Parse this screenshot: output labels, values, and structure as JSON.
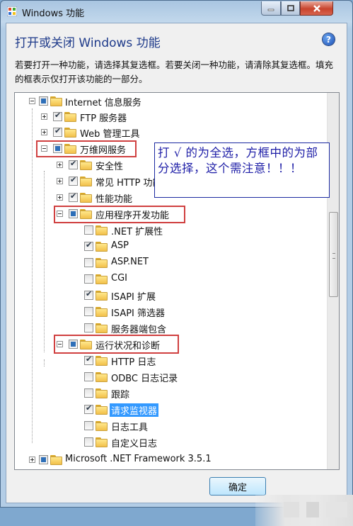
{
  "window": {
    "title": "Windows 功能",
    "heading": "打开或关闭 Windows 功能",
    "description": "若要打开一种功能，请选择其复选框。若要关闭一种功能，请清除其复选框。填充的框表示仅打开该功能的一部分。",
    "help_glyph": "?"
  },
  "tree": {
    "internet_info_services": "Internet 信息服务",
    "ftp_server": "FTP 服务器",
    "web_management_tools": "Web 管理工具",
    "www_services": "万维网服务",
    "security": "安全性",
    "common_http": "常见 HTTP 功能",
    "performance": "性能功能",
    "app_dev": "应用程序开发功能",
    "net_extensibility": ".NET 扩展性",
    "asp": "ASP",
    "aspnet": "ASP.NET",
    "cgi": "CGI",
    "isapi_ext": "ISAPI 扩展",
    "isapi_filters": "ISAPI 筛选器",
    "ssi": "服务器端包含",
    "health_diag": "运行状况和诊断",
    "http_logging": "HTTP 日志",
    "odbc_logging": "ODBC 日志记录",
    "tracing": "跟踪",
    "request_monitor": "请求监视器",
    "logging_tools": "日志工具",
    "custom_logging": "自定义日志",
    "dotnet_framework": "Microsoft .NET Framework 3.5.1"
  },
  "annotation": {
    "text": "打 √ 的为全选，方框中的为部分选择，这个需注意！！！"
  },
  "buttons": {
    "ok_label": "确定"
  },
  "colors": {
    "selection": "#3399ff",
    "heading": "#1e3a8a",
    "annotation_text": "#2020a8",
    "highlight_box": "#d04040"
  }
}
